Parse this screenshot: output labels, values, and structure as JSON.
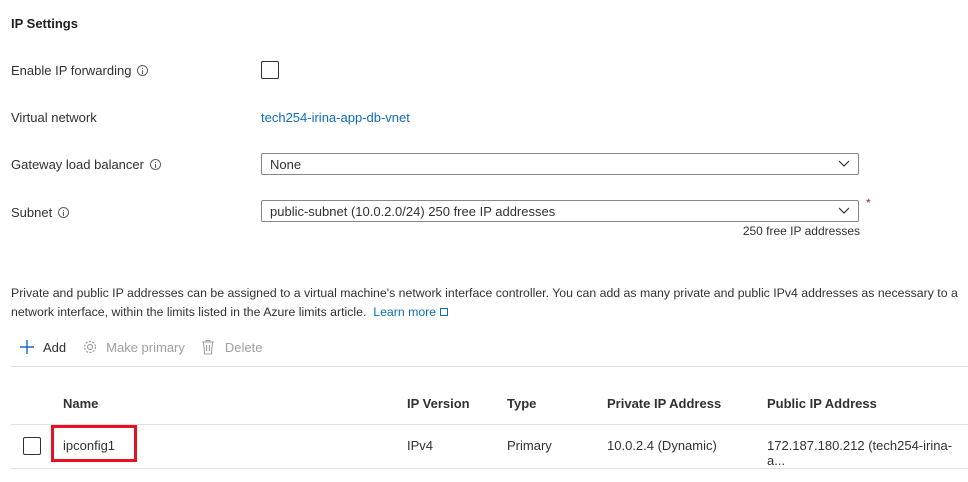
{
  "section": {
    "title": "IP Settings"
  },
  "fields": {
    "ip_forwarding": {
      "label": "Enable IP forwarding",
      "checked": false
    },
    "virtual_network": {
      "label": "Virtual network",
      "value": "tech254-irina-app-db-vnet"
    },
    "gateway_lb": {
      "label": "Gateway load balancer",
      "value": "None"
    },
    "subnet": {
      "label": "Subnet",
      "value": "public-subnet (10.0.2.0/24) 250 free IP addresses",
      "required_mark": "*",
      "hint": "250 free IP addresses"
    }
  },
  "description": {
    "text": "Private and public IP addresses can be assigned to a virtual machine's network interface controller. You can add as many private and public IPv4 addresses as necessary to a network interface, within the limits listed in the Azure limits article.",
    "learn_more": "Learn more"
  },
  "toolbar": {
    "add": "Add",
    "make_primary": "Make primary",
    "delete": "Delete"
  },
  "table": {
    "headers": [
      "Name",
      "IP Version",
      "Type",
      "Private IP Address",
      "Public IP Address"
    ],
    "rows": [
      [
        "ipconfig1",
        "IPv4",
        "Primary",
        "10.0.2.4 (Dynamic)",
        "172.187.180.212 (tech254-irina-a..."
      ]
    ]
  },
  "colors": {
    "link": "#0f6cbd",
    "highlight": "#e81123"
  }
}
